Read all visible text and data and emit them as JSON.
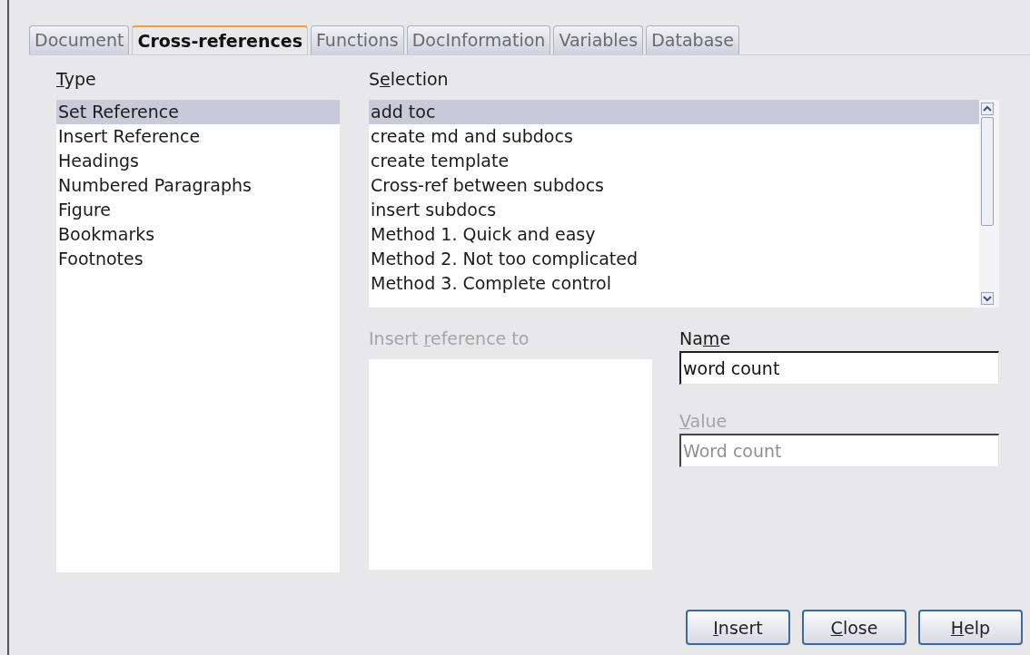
{
  "tabs": [
    {
      "label": "Document",
      "selected": false
    },
    {
      "label": "Cross-references",
      "selected": true
    },
    {
      "label": "Functions",
      "selected": false
    },
    {
      "label": "DocInformation",
      "selected": false
    },
    {
      "label": "Variables",
      "selected": false
    },
    {
      "label": "Database",
      "selected": false
    }
  ],
  "type": {
    "label": {
      "key": "T",
      "after": "ype"
    },
    "items": [
      {
        "label": "Set Reference",
        "selected": true
      },
      {
        "label": "Insert Reference",
        "selected": false
      },
      {
        "label": "Headings",
        "selected": false
      },
      {
        "label": "Numbered Paragraphs",
        "selected": false
      },
      {
        "label": "Figure",
        "selected": false
      },
      {
        "label": "Bookmarks",
        "selected": false
      },
      {
        "label": "Footnotes",
        "selected": false
      }
    ]
  },
  "selection": {
    "label": {
      "before": "S",
      "key": "e",
      "after": "lection"
    },
    "items": [
      {
        "label": "add toc",
        "selected": true
      },
      {
        "label": "create md and subdocs",
        "selected": false
      },
      {
        "label": "create template",
        "selected": false
      },
      {
        "label": "Cross-ref between subdocs",
        "selected": false
      },
      {
        "label": "insert subdocs",
        "selected": false
      },
      {
        "label": "Method 1. Quick and easy",
        "selected": false
      },
      {
        "label": "Method 2. Not too complicated",
        "selected": false
      },
      {
        "label": "Method 3. Complete control",
        "selected": false
      }
    ]
  },
  "insert_reference_to": {
    "label": {
      "before": "Insert ",
      "key": "r",
      "after": "eference to"
    },
    "disabled": true
  },
  "name": {
    "label": {
      "before": "Na",
      "key": "m",
      "after": "e"
    },
    "value": "word count",
    "disabled": false
  },
  "value": {
    "label": {
      "key": "V",
      "after": "alue"
    },
    "value": "Word count",
    "disabled": true
  },
  "buttons": [
    {
      "label": {
        "key": "I",
        "after": "nsert"
      }
    },
    {
      "label": {
        "key": "C",
        "after": "lose"
      }
    },
    {
      "label": {
        "key": "H",
        "after": "elp"
      }
    }
  ]
}
